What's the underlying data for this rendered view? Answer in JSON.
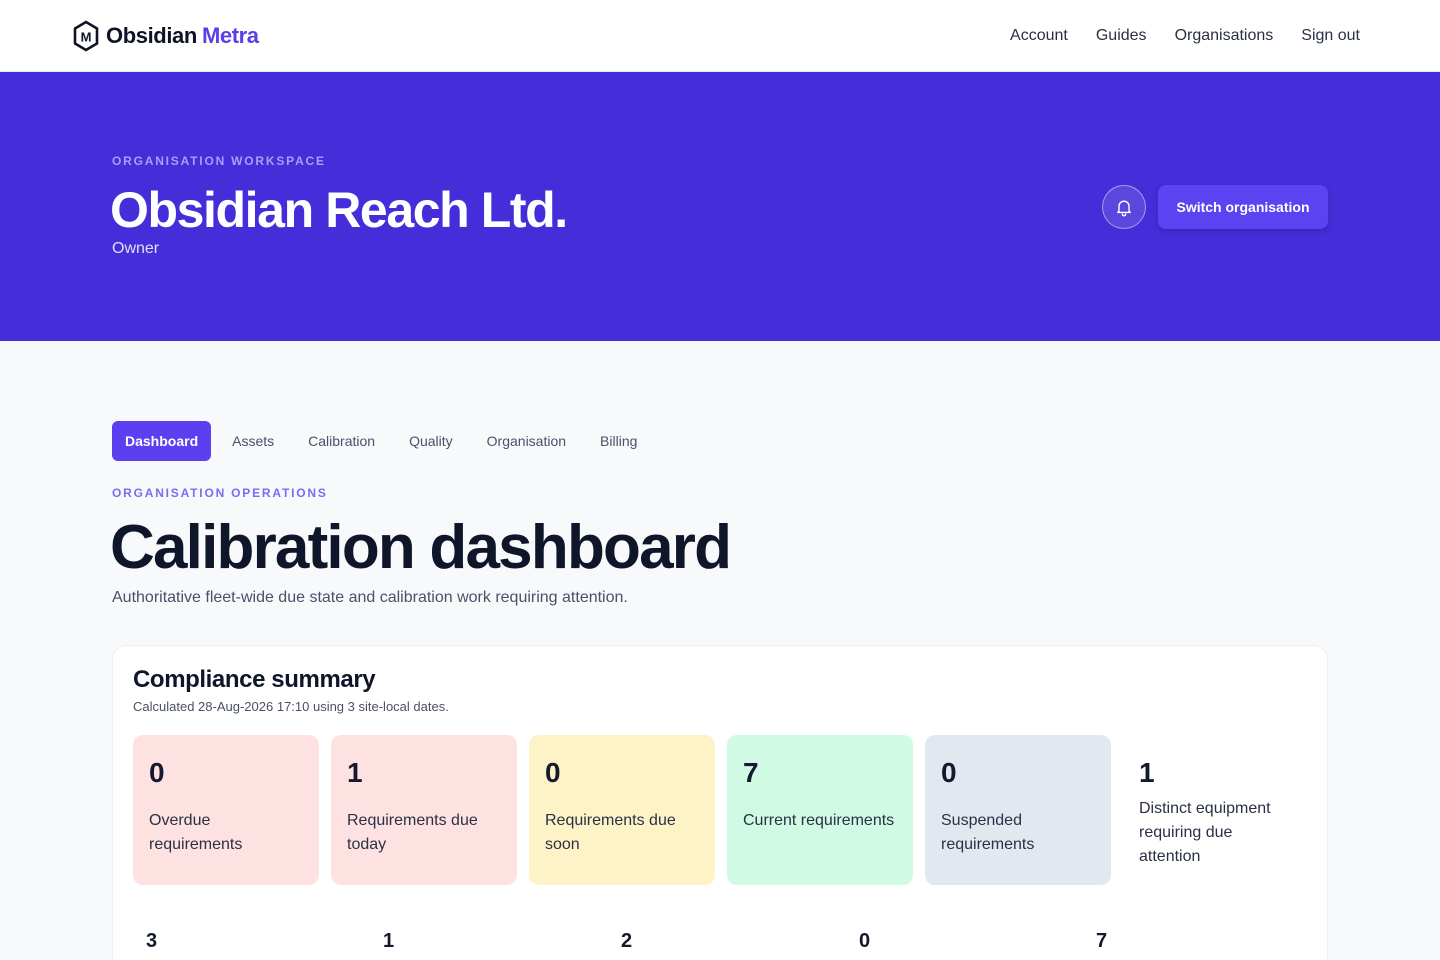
{
  "brand": {
    "name": "Obsidian",
    "accent": "Metra",
    "logo_letter": "M"
  },
  "nav": [
    {
      "label": "Account"
    },
    {
      "label": "Guides"
    },
    {
      "label": "Organisations"
    },
    {
      "label": "Sign out"
    }
  ],
  "hero": {
    "eyebrow": "ORGANISATION WORKSPACE",
    "org_name": "Obsidian Reach Ltd.",
    "role": "Owner",
    "switch_label": "Switch organisation",
    "bell_icon": "bell-icon"
  },
  "tabs": [
    {
      "label": "Dashboard",
      "active": true
    },
    {
      "label": "Assets"
    },
    {
      "label": "Calibration"
    },
    {
      "label": "Quality"
    },
    {
      "label": "Organisation"
    },
    {
      "label": "Billing"
    }
  ],
  "page": {
    "eyebrow": "ORGANISATION OPERATIONS",
    "title": "Calibration dashboard",
    "subtitle": "Authoritative fleet-wide due state and calibration work requiring attention."
  },
  "summary": {
    "title": "Compliance summary",
    "note": "Calculated 28-Aug-2026 17:10 using 3 site-local dates.",
    "stats": [
      {
        "value": "0",
        "label": "Overdue requirements",
        "color": "#fee2e2"
      },
      {
        "value": "1",
        "label": "Requirements due today",
        "color": "#fee2e2"
      },
      {
        "value": "0",
        "label": "Requirements due soon",
        "color": "#fef3c7"
      },
      {
        "value": "7",
        "label": "Current requirements",
        "color": "#d1fae5"
      },
      {
        "value": "0",
        "label": "Suspended requirements",
        "color": "#e2e8f0"
      },
      {
        "value": "1",
        "label": "Distinct equipment requiring due attention",
        "color": "#ffffff"
      }
    ],
    "row2_values": [
      "3",
      "1",
      "2",
      "0",
      "7"
    ]
  },
  "colors": {
    "hero_bg": "#452ed9",
    "accent": "#5b3ff0"
  }
}
